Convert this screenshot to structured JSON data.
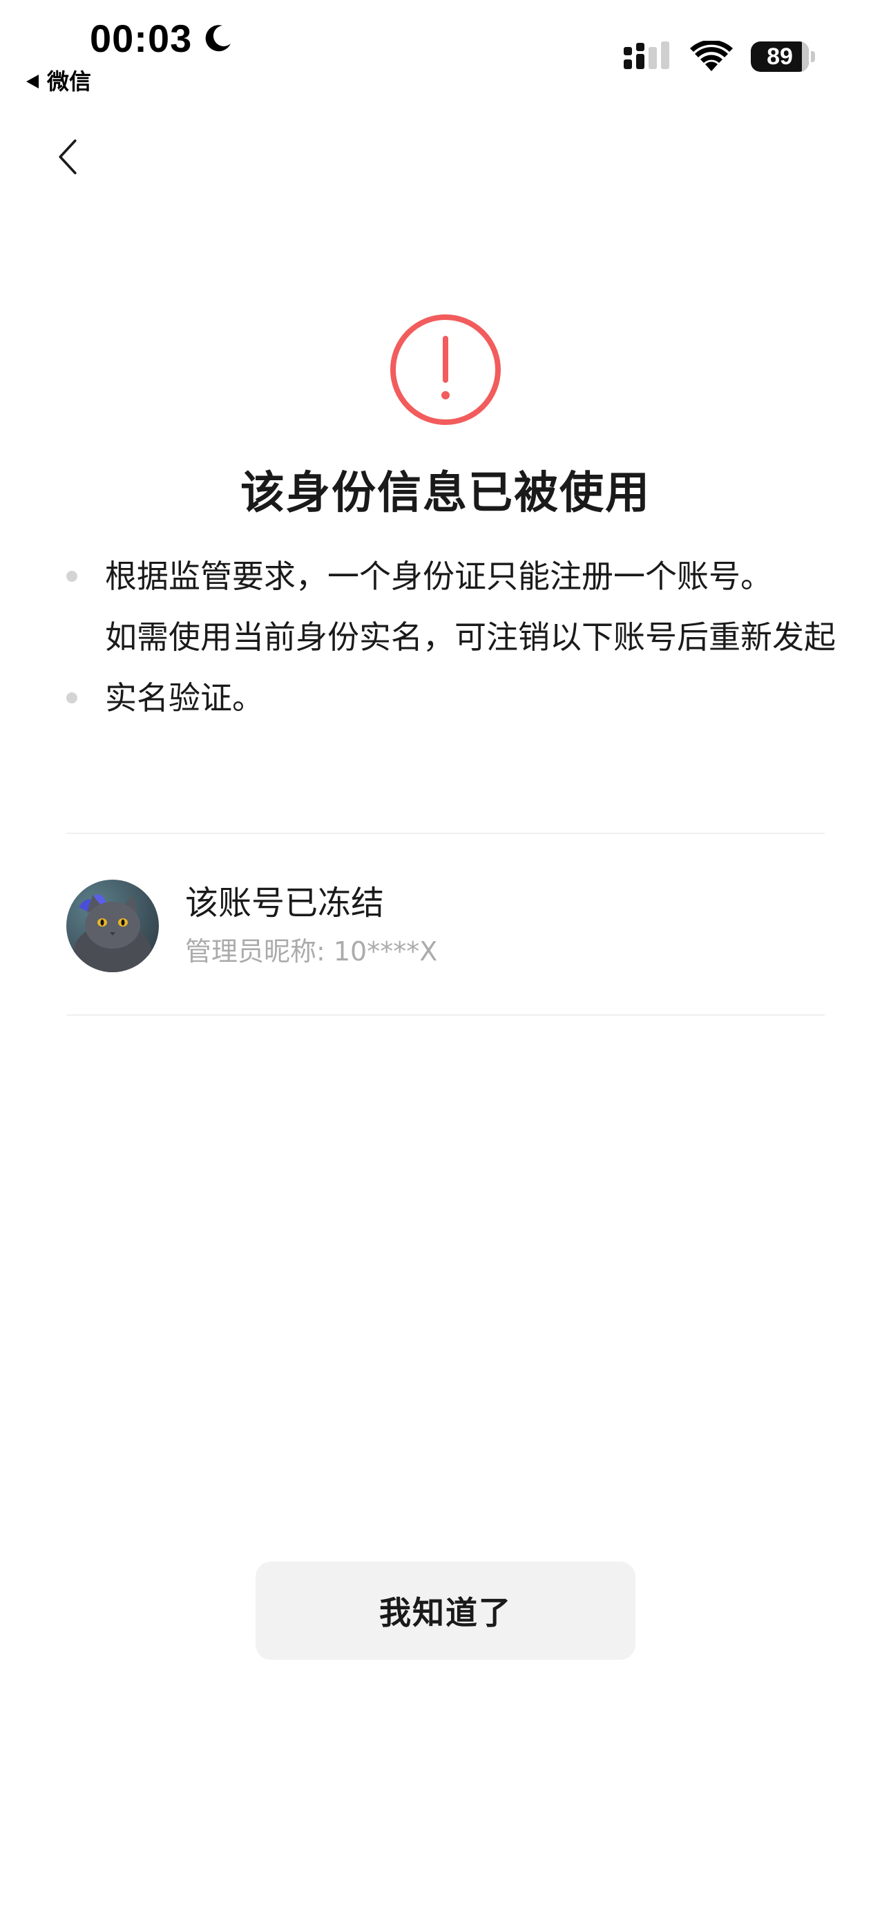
{
  "status_bar": {
    "time": "00:03",
    "back_app_label": "微信",
    "battery_level": "89",
    "icons": [
      "moon-icon",
      "signal-icon",
      "wifi-icon",
      "battery-icon"
    ]
  },
  "nav": {
    "back_icon": "chevron-left-icon"
  },
  "notice": {
    "icon": "exclamation-circle-icon",
    "icon_color": "#F25C5C",
    "title": "该身份信息已被使用",
    "items": [
      "根据监管要求，一个身份证只能注册一个账号。",
      "如需使用当前身份实名，可注销以下账号后重新发起实名验证。"
    ]
  },
  "account": {
    "avatar": "cat-avatar",
    "name": "该账号已冻结",
    "admin_nickname": "管理员昵称: 10****X"
  },
  "button": {
    "label": "我知道了",
    "background": "#F2F2F2"
  }
}
